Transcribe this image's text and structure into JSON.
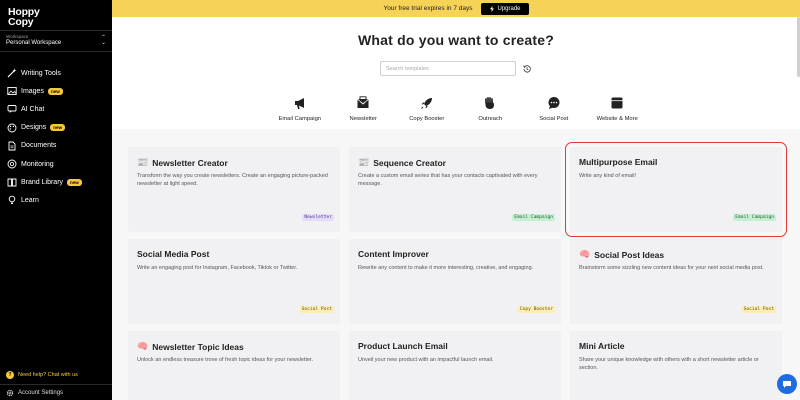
{
  "sidebar": {
    "logo_line1": "Hoppy",
    "logo_line2": "Copy",
    "workspace_label": "Workspace",
    "workspace_name": "Personal Workspace",
    "items": [
      {
        "label": "Writing Tools",
        "icon": "wand-icon",
        "badge": ""
      },
      {
        "label": "Images",
        "icon": "image-icon",
        "badge": "new"
      },
      {
        "label": "AI Chat",
        "icon": "chat-icon",
        "badge": ""
      },
      {
        "label": "Designs",
        "icon": "palette-icon",
        "badge": "new"
      },
      {
        "label": "Documents",
        "icon": "document-icon",
        "badge": ""
      },
      {
        "label": "Monitoring",
        "icon": "monitor-icon",
        "badge": ""
      },
      {
        "label": "Brand Library",
        "icon": "book-icon",
        "badge": "new"
      },
      {
        "label": "Learn",
        "icon": "lightbulb-icon",
        "badge": ""
      }
    ],
    "help_text": "Need help? Chat with us",
    "account_label": "Account Settings"
  },
  "banner": {
    "text": "Your free trial expires in 7 days",
    "upgrade_label": "Upgrade"
  },
  "main": {
    "title": "What do you want to create?",
    "search_placeholder": "Search templates",
    "categories": [
      {
        "label": "Email Campaign",
        "icon": "megaphone-icon"
      },
      {
        "label": "Newsletter",
        "icon": "newsletter-icon"
      },
      {
        "label": "Copy Booster",
        "icon": "rocket-icon"
      },
      {
        "label": "Outreach",
        "icon": "hand-icon"
      },
      {
        "label": "Social Post",
        "icon": "speech-bubble-icon"
      },
      {
        "label": "Website & More",
        "icon": "browser-icon"
      }
    ],
    "cards": [
      {
        "title": "Newsletter Creator",
        "emoji": "📰",
        "description": "Transform the way you create newsletters. Create an engaging picture-packed newsletter at light speed.",
        "tag": "Newsletter"
      },
      {
        "title": "Sequence Creator",
        "emoji": "📰",
        "description": "Create a custom email series that has your contacts captivated with every message.",
        "tag": "Email Campaign"
      },
      {
        "title": "Multipurpose Email",
        "emoji": "",
        "description": "Write any kind of email!",
        "tag": "Email Campaign"
      },
      {
        "title": "Social Media Post",
        "emoji": "",
        "description": "Write an engaging post for Instagram, Facebook, Tiktok or Twitter.",
        "tag": "Social Post"
      },
      {
        "title": "Content Improver",
        "emoji": "",
        "description": "Rewrite any content to make it more interesting, creative, and engaging.",
        "tag": "Copy Booster"
      },
      {
        "title": "Social Post Ideas",
        "emoji": "🧠",
        "description": "Brainstorm some sizzling new content ideas for your next social media post.",
        "tag": "Social Post"
      },
      {
        "title": "Newsletter Topic Ideas",
        "emoji": "🧠",
        "description": "Unlock an endless treasure trove of fresh topic ideas for your newsletter.",
        "tag": ""
      },
      {
        "title": "Product Launch Email",
        "emoji": "",
        "description": "Unveil your new product with an impactful launch email.",
        "tag": ""
      },
      {
        "title": "Mini Article",
        "emoji": "",
        "description": "Share your unique knowledge with others with a short newsletter article or section.",
        "tag": ""
      }
    ]
  },
  "colors": {
    "banner": "#f6d357",
    "sidebar": "#000000",
    "accent_yellow": "#f6c93a",
    "selection_outline": "#e03a3a",
    "chat_fab": "#1d6ce0"
  }
}
